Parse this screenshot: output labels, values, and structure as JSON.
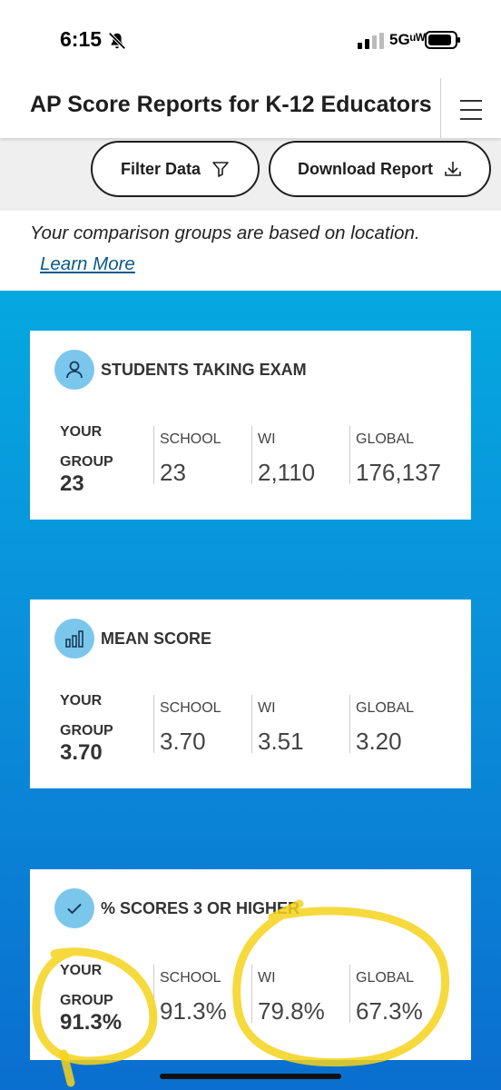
{
  "status_bar": {
    "time": "6:15",
    "network": "5Gᵘᵂ"
  },
  "header": {
    "title": "AP Score Reports for K-12 Educators"
  },
  "toolbar": {
    "filter_label": "Filter Data",
    "download_label": "Download Report"
  },
  "notice": {
    "text": "Your comparison groups are based on location.",
    "link": "Learn More"
  },
  "cards": [
    {
      "title": "STUDENTS TAKING EXAM",
      "icon": "person-icon",
      "your_group_label": "YOUR GROUP",
      "your_group_value": "23",
      "columns": [
        {
          "label": "SCHOOL",
          "value": "23"
        },
        {
          "label": "WI",
          "value": "2,110"
        },
        {
          "label": "GLOBAL",
          "value": "176,137"
        }
      ]
    },
    {
      "title": "MEAN SCORE",
      "icon": "bar-chart-icon",
      "your_group_label": "YOUR GROUP",
      "your_group_value": "3.70",
      "columns": [
        {
          "label": "SCHOOL",
          "value": "3.70"
        },
        {
          "label": "WI",
          "value": "3.51"
        },
        {
          "label": "GLOBAL",
          "value": "3.20"
        }
      ]
    },
    {
      "title": "% SCORES 3 OR HIGHER",
      "icon": "checkmark-icon",
      "your_group_label": "YOUR GROUP",
      "your_group_value": "91.3%",
      "columns": [
        {
          "label": "SCHOOL",
          "value": "91.3%"
        },
        {
          "label": "WI",
          "value": "79.8%"
        },
        {
          "label": "GLOBAL",
          "value": "67.3%"
        }
      ]
    }
  ],
  "colors": {
    "highlight": "#f5d21b",
    "accent_blue": "#0a8fd9",
    "icon_circle": "#7bc7ec",
    "link": "#0b5a8a"
  }
}
